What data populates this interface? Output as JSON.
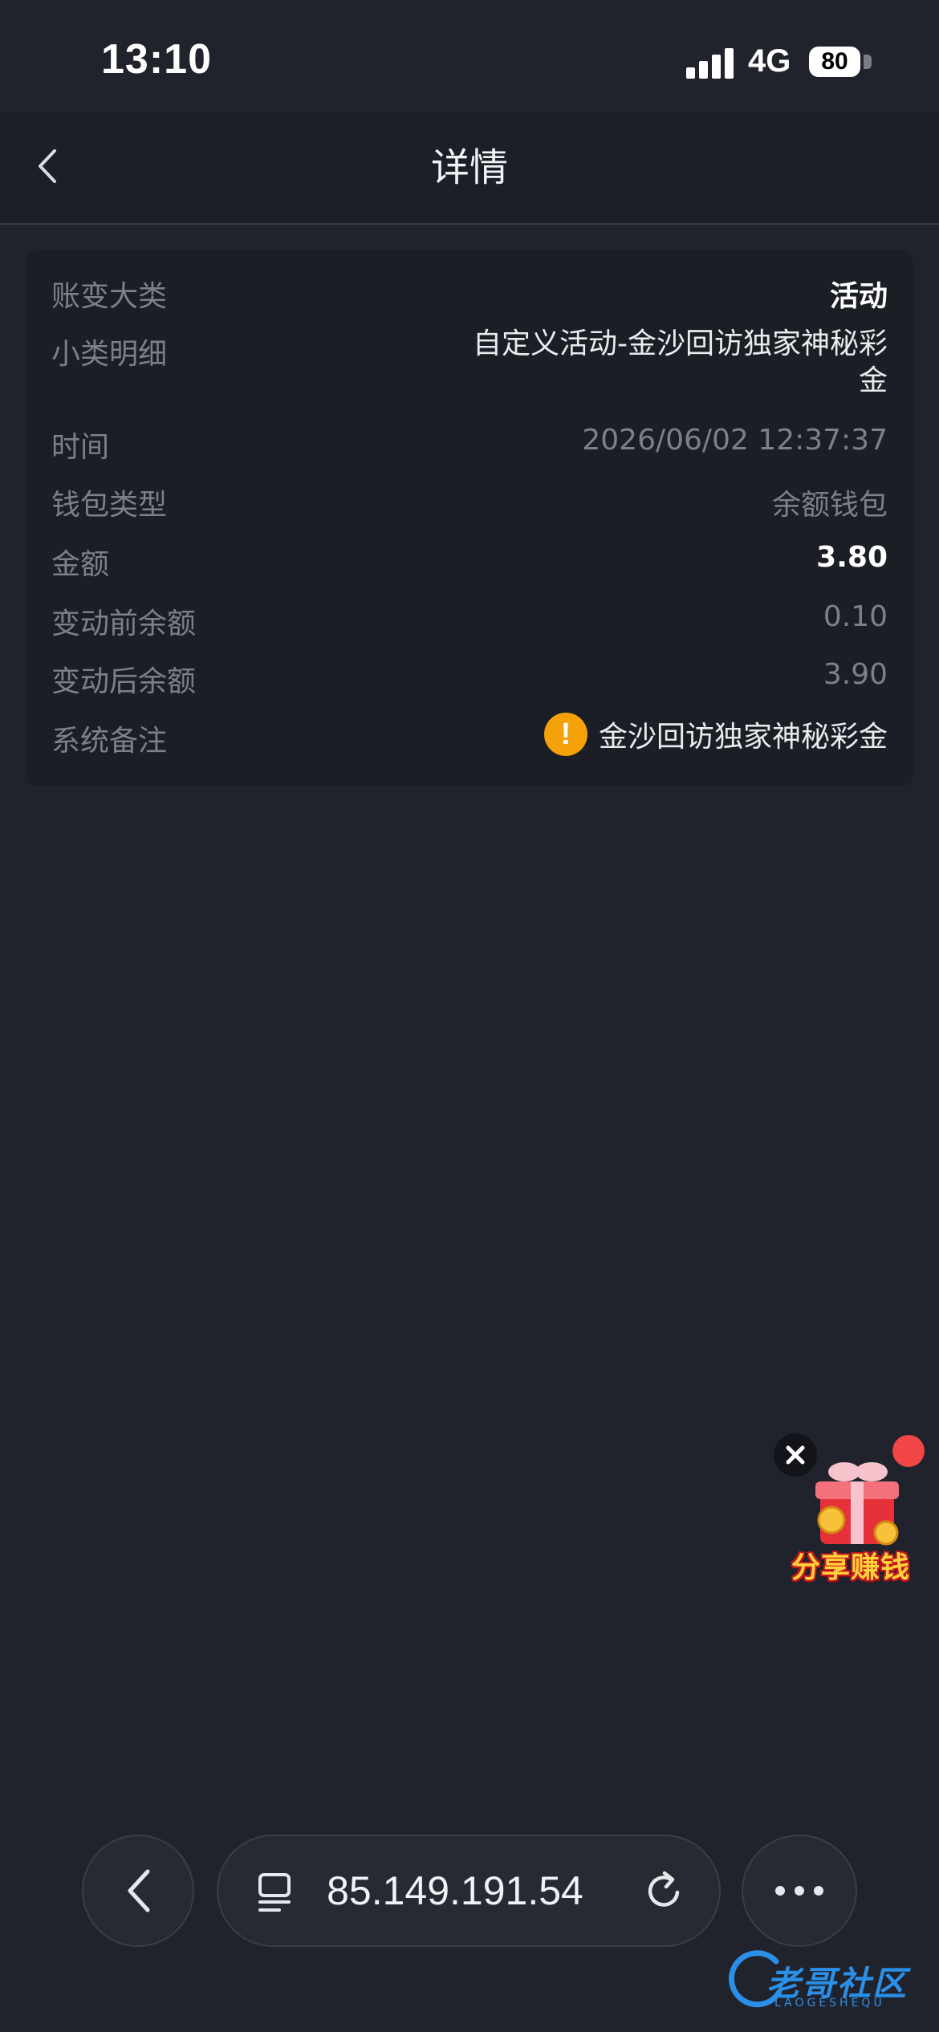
{
  "status_bar": {
    "time": "13:10",
    "network": "4G",
    "battery": "80"
  },
  "header": {
    "title": "详情"
  },
  "details": {
    "category": {
      "label": "账变大类",
      "value": "活动"
    },
    "subcategory": {
      "label": "小类明细",
      "value": "自定义活动-金沙回访独家神秘彩金"
    },
    "time": {
      "label": "时间",
      "value": "2026/06/02 12:37:37"
    },
    "wallet_type": {
      "label": "钱包类型",
      "value": "余额钱包"
    },
    "amount": {
      "label": "金额",
      "value": "3.80"
    },
    "balance_before": {
      "label": "变动前余额",
      "value": "0.10"
    },
    "balance_after": {
      "label": "变动后余额",
      "value": "3.90"
    },
    "remark": {
      "label": "系统备注",
      "value": "金沙回访独家神秘彩金",
      "icon": "warning-icon"
    }
  },
  "share_widget": {
    "label": "分享赚钱"
  },
  "browser_bar": {
    "url": "85.149.191.54"
  },
  "watermark": {
    "text": "老哥社区",
    "subtext": "LAOGESHEQU"
  },
  "colors": {
    "background": "#20232c",
    "card": "#1b1e25",
    "label": "#7b808b",
    "warning": "#f5a10a"
  }
}
